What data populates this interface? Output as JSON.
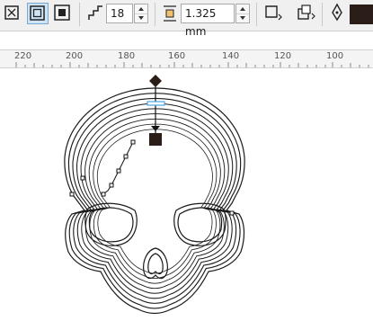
{
  "toolbar": {
    "contour_inside_icon": "contour-center-icon",
    "contour_steps_value": "18",
    "contour_offset_value": "1.325 mm",
    "steps_icon": "contour-steps-icon",
    "offset_icon": "contour-offset-icon",
    "outline_icon": "pen-nib-icon",
    "fill_color": "#2b1d17"
  },
  "ruler": {
    "labels": [
      "220",
      "200",
      "180",
      "160",
      "140",
      "120",
      "100"
    ]
  },
  "canvas": {
    "object": "skull-contour-artwork",
    "selection_handle_color": "#2b1d17",
    "midpoint_bar_color": "#4aa3df"
  }
}
